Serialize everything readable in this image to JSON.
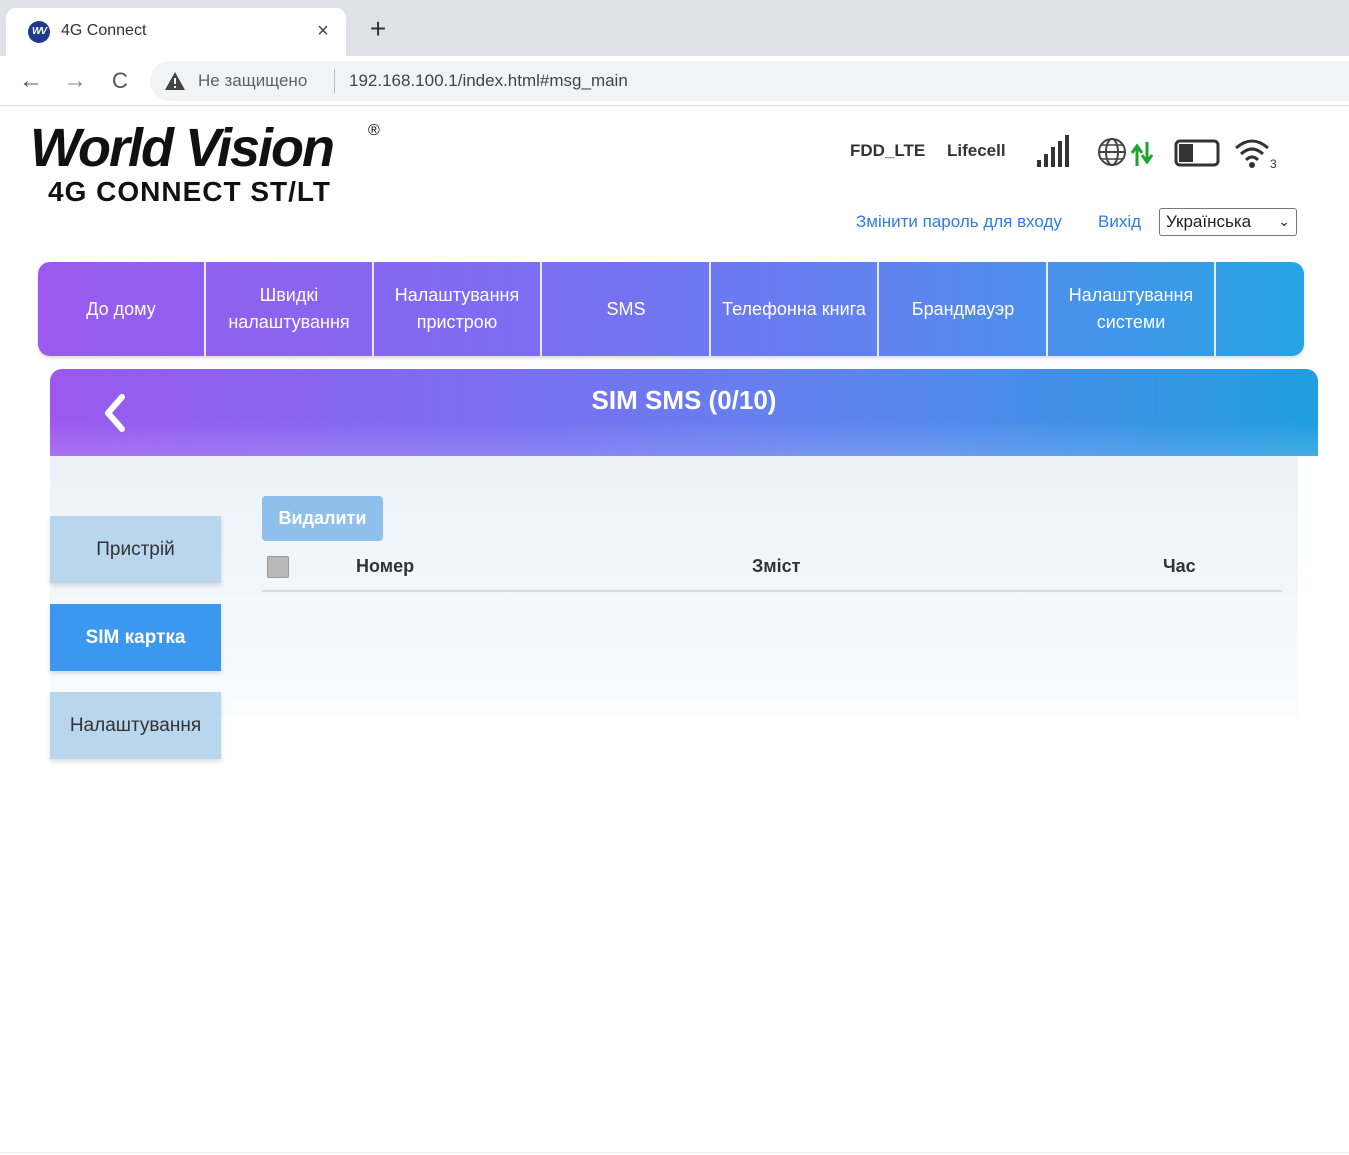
{
  "browser": {
    "tab_title": "4G Connect",
    "tab_favicon_text": "WV",
    "tab_close": "×",
    "new_tab": "+",
    "not_secure": "Не защищено",
    "url": "192.168.100.1/index.html#msg_main",
    "back": "←",
    "forward": "→",
    "reload": "C"
  },
  "logo": {
    "main": "World Vision",
    "registered": "®",
    "sub": "4G CONNECT ST/LT"
  },
  "status": {
    "network_type": "FDD_LTE",
    "operator": "Lifecell",
    "signal_icon": "signal-bars-icon",
    "globe_icon": "globe-icon",
    "data_icon": "data-arrows-icon",
    "battery_icon": "battery-icon",
    "wifi_icon": "wifi-icon",
    "wifi_clients": "3",
    "data_arrow_color": "#1aa52b"
  },
  "header_links": {
    "change_password": "Змінити пароль для входу",
    "logout": "Вихід",
    "language": "Українська"
  },
  "nav": {
    "items": [
      {
        "label": "До дому"
      },
      {
        "label": "Швидкі налаштування"
      },
      {
        "label": "Налаштування пристрою"
      },
      {
        "label": "SMS"
      },
      {
        "label": "Телефонна книга"
      },
      {
        "label": "Брандмауэр"
      },
      {
        "label": "Налаштування системи"
      }
    ]
  },
  "banner": {
    "title": "SIM SMS (0/10)"
  },
  "sidebar": {
    "items": [
      {
        "label": "Пристрій",
        "active": false
      },
      {
        "label": "SIM картка",
        "active": true
      },
      {
        "label": "Налаштування",
        "active": false
      }
    ]
  },
  "sms_table": {
    "delete_label": "Видалити",
    "columns": [
      "Номер",
      "Зміст",
      "Час"
    ],
    "rows": []
  },
  "colors": {
    "accent_blue": "#3b97f0",
    "link_blue": "#2b7de9",
    "gradient_start": "#9b59f0",
    "gradient_end": "#1f9ee0"
  }
}
